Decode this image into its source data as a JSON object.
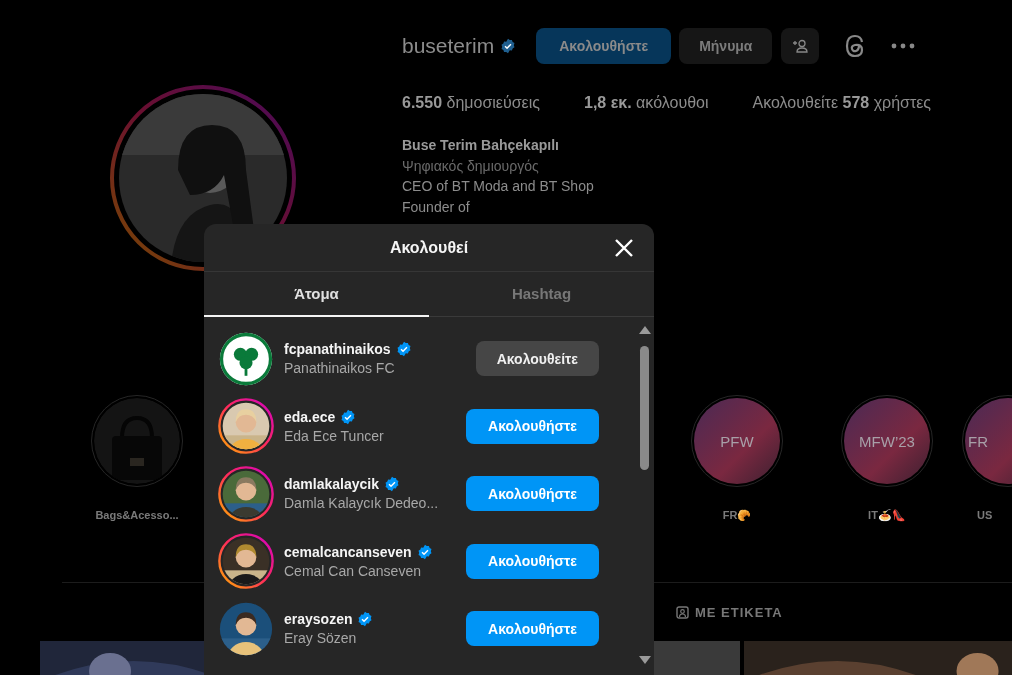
{
  "profile": {
    "username": "buseterim",
    "verified": true,
    "buttons": [
      {
        "label": "Ακολουθήστε",
        "kind": "primary"
      },
      {
        "label": "Μήνυμα",
        "kind": "secondary"
      }
    ],
    "stats": [
      "**6.550** δημοσιεύσεις",
      "**1,8 εκ.** ακόλουθοι",
      "Ακολουθείτε **578** χρήστες"
    ],
    "bio": {
      "name": "Buse Terim Bahçekapılı",
      "category": "Ψηφιακός δημιουργός",
      "lines": [
        "CEO of BT Moda and BT Shop",
        "Founder of"
      ]
    }
  },
  "highlights": [
    {
      "label": "Bags&Acesso...",
      "kind": "picture"
    },
    {
      "label": "FR🥐",
      "kind": "cover",
      "cover_text": "PFW"
    },
    {
      "label": "IT🍝👠",
      "kind": "cover",
      "cover_text": "MFW’23"
    },
    {
      "label": "US",
      "kind": "cover",
      "cover_text": "FR"
    }
  ],
  "profile_tabs": [
    {
      "label": "ΜΕ ΕΤΙΚΕΤΑ",
      "selected": false
    }
  ],
  "modal": {
    "title": "Ακολουθεί",
    "tabs": [
      {
        "label": "Άτομα",
        "selected": true
      },
      {
        "label": "Hashtag",
        "selected": false
      }
    ],
    "accounts": [
      {
        "username": "fcpanathinaikos",
        "full_name": "Panathinaikos FC",
        "verified": true,
        "story": false,
        "following": true,
        "button": "Ακολουθείτε"
      },
      {
        "username": "eda.ece",
        "full_name": "Eda Ece Tuncer",
        "verified": true,
        "story": true,
        "following": false,
        "button": "Ακολουθήστε"
      },
      {
        "username": "damlakalaycik",
        "full_name": "Damla Kalaycık Dedeo...",
        "verified": true,
        "story": true,
        "following": false,
        "button": "Ακολουθήστε"
      },
      {
        "username": "cemalcancanseven",
        "full_name": "Cemal Can Canseven",
        "verified": true,
        "story": true,
        "following": false,
        "button": "Ακολουθήστε"
      },
      {
        "username": "eraysozen",
        "full_name": "Eray Sözen",
        "verified": true,
        "story": false,
        "following": false,
        "button": "Ακολουθήστε"
      }
    ]
  }
}
